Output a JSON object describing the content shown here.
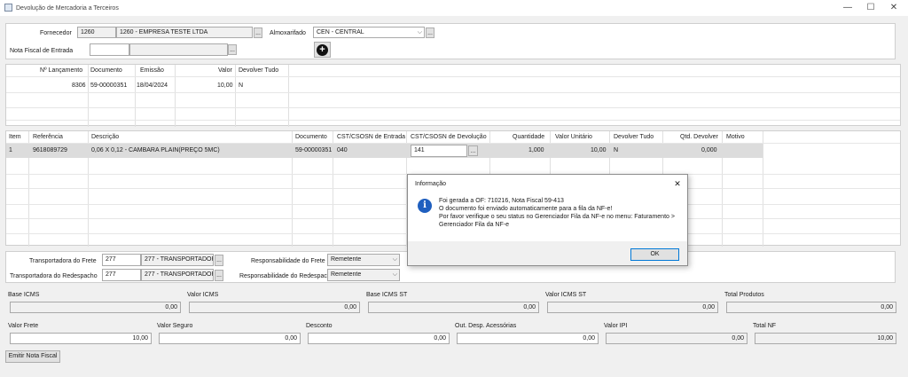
{
  "window": {
    "title": "Devolução de Mercadoria a Terceiros"
  },
  "filter": {
    "fornecedor_label": "Fornecedor",
    "fornecedor_code": "1260",
    "fornecedor_name": "1260 - EMPRESA TESTE LTDA",
    "almoxarifado_label": "Almoxarifado",
    "almoxarifado_value": "CEN - CENTRAL",
    "nota_label": "Nota Fiscal de Entrada",
    "nota_value": "",
    "ellipsis": "..."
  },
  "top_table": {
    "headers": [
      "Nº Lançamento",
      "Documento",
      "Emissão",
      "Valor",
      "Devolver Tudo"
    ],
    "rows": [
      [
        "8306",
        "59-00000351",
        "18/04/2024",
        "10,00",
        "N"
      ]
    ]
  },
  "items_table": {
    "headers": [
      "Item",
      "Referência",
      "Descrição",
      "Documento",
      "CST/CSOSN de Entrada",
      "CST/CSOSN de Devolução",
      "Quantidade",
      "Valor Unitário",
      "Devolver Tudo",
      "Qtd. Devolver",
      "Motivo"
    ],
    "rows": [
      [
        "1",
        "9618089729",
        "0,06 X 0,12 - CAMBARA PLAIN(PREÇO 5MC)",
        "59-00000351",
        "040",
        "141",
        "1,000",
        "10,00",
        "N",
        "0,000",
        ""
      ]
    ]
  },
  "freight": {
    "transp_frete_label": "Transportadora do Frete",
    "transp_frete_code": "277",
    "transp_frete_name": "277 - TRANSPORTADOR",
    "transp_redesp_label": "Transportadora do Redespacho",
    "transp_redesp_code": "277",
    "transp_redesp_name": "277 - TRANSPORTADOR",
    "resp_frete_label": "Responsabilidade do Frete",
    "resp_frete_value": "Remetente",
    "resp_redesp_label": "Responsabilidade do Redespacho",
    "resp_redesp_value": "Remetente"
  },
  "totals": {
    "base_icms_label": "Base ICMS",
    "base_icms": "0,00",
    "valor_icms_label": "Valor ICMS",
    "valor_icms": "0,00",
    "base_icms_st_label": "Base ICMS ST",
    "base_icms_st": "0,00",
    "valor_icms_st_label": "Valor ICMS ST",
    "valor_icms_st": "0,00",
    "total_produtos_label": "Total Produtos",
    "total_produtos": "0,00",
    "valor_frete_label": "Valor Frete",
    "valor_frete": "10,00",
    "valor_seguro_label": "Valor Seguro",
    "valor_seguro": "0,00",
    "desconto_label": "Desconto",
    "desconto": "0,00",
    "out_desp_label": "Out. Desp. Acessórias",
    "out_desp": "0,00",
    "valor_ipi_label": "Valor IPI",
    "valor_ipi": "0,00",
    "total_nf_label": "Total NF",
    "total_nf": "10,00"
  },
  "actions": {
    "emitir_label": "Emitir Nota Fiscal"
  },
  "dialog": {
    "title": "Informação",
    "lines": [
      "Foi gerada a OF: 710216, Nota Fiscal 59-413",
      "O documento foi enviado automaticamente para a fila da NF-e!",
      "Por favor verifique o seu status no Gerenciador Fila da NF-e no menu: Faturamento >",
      "Gerenciador Fila da NF-e"
    ],
    "ok_label": "OK"
  },
  "colors": {
    "selected_row": "#dcdcdc",
    "info_icon": "#1f5fbf",
    "ok_border": "#0078d7"
  }
}
